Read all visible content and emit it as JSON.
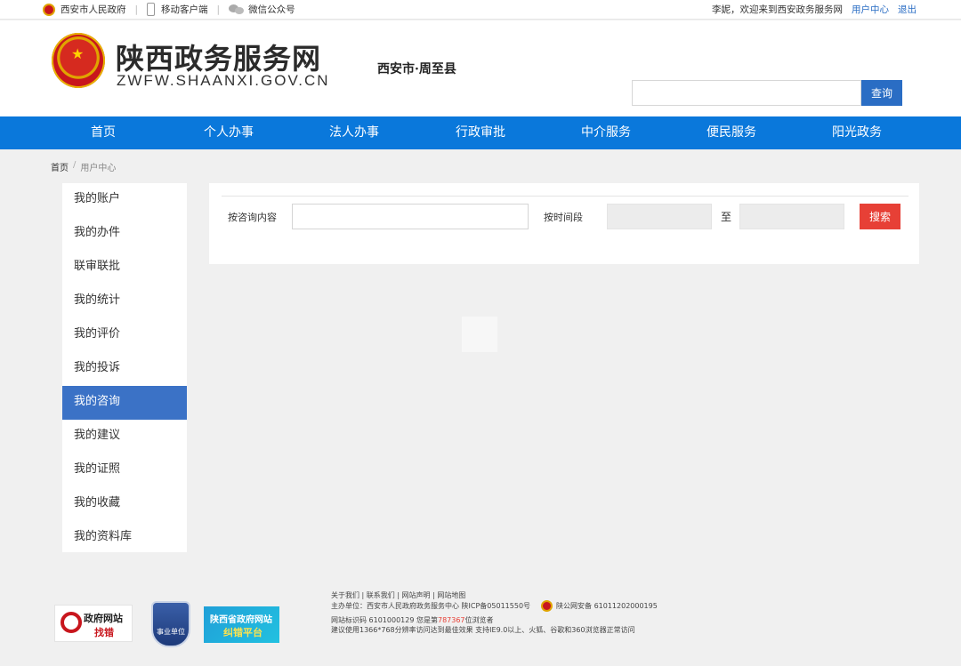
{
  "topbar": {
    "gov_link": "西安市人民政府",
    "mobile_link": "移动客户端",
    "wechat_link": "微信公众号",
    "welcome": "李妮，欢迎来到西安政务服务网",
    "user_center": "用户中心",
    "logout": "退出"
  },
  "header": {
    "title": "陕西政务服务网",
    "subtitle": "ZWFW.SHAANXI.GOV.CN",
    "region": "西安市·周至县",
    "search_placeholder": "",
    "search_button": "查询"
  },
  "nav": {
    "items": [
      "首页",
      "个人办事",
      "法人办事",
      "行政审批",
      "中介服务",
      "便民服务",
      "阳光政务"
    ]
  },
  "breadcrumb": {
    "home": "首页",
    "current": "用户中心"
  },
  "sidebar": {
    "items": [
      "我的账户",
      "我的办件",
      "联审联批",
      "我的统计",
      "我的评价",
      "我的投诉",
      "我的咨询",
      "我的建议",
      "我的证照",
      "我的收藏",
      "我的资料库"
    ],
    "active_index": 6
  },
  "filter": {
    "content_label": "按咨询内容",
    "content_value": "",
    "time_label": "按时间段",
    "start_value": "",
    "to_label": "至",
    "end_value": "",
    "search_button": "搜索"
  },
  "footer": {
    "badge_error_title": "政府网站",
    "badge_error_sub": "找错",
    "badge_unit": "事业单位",
    "badge_platform_title": "陕西省政府网站",
    "badge_platform_sub": "纠错平台",
    "links_line": "关于我们    |    联系我们    |    网站声明    |    网站地图",
    "host_line": "主办单位：西安市人民政府政务服务中心    陕ICP备05011550号",
    "police_record": "陕公网安备 61011202000195",
    "site_code_prefix": "网站标识码 6101000129    您是第",
    "visitor_count": "787367",
    "site_code_suffix": "位浏览者",
    "browser_line": "建议使用1366*768分辨率访问达到最佳效果    支持IE9.0以上、火狐、谷歌和360浏览器正常访问"
  },
  "colors": {
    "nav_blue": "#0a78db",
    "active_blue": "#3b72c6",
    "search_red": "#e74036"
  }
}
